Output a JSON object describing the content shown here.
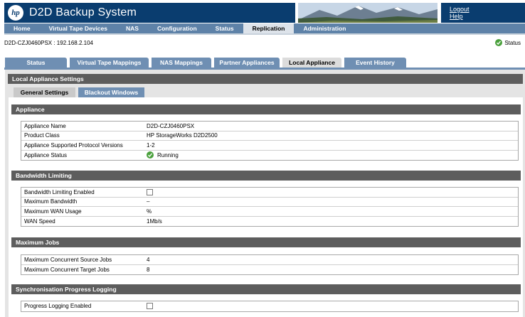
{
  "header": {
    "logo_text": "hp",
    "title": "D2D Backup System",
    "logout_label": "Logout",
    "help_label": "Help"
  },
  "nav": {
    "items": [
      "Home",
      "Virtual Tape Devices",
      "NAS",
      "Configuration",
      "Status",
      "Replication",
      "Administration"
    ],
    "active": "Replication"
  },
  "host": {
    "line": "D2D-CZJ0460PSX : 192.168.2.104",
    "status_label": "Status"
  },
  "tabs": {
    "items": [
      "Status",
      "Virtual Tape Mappings",
      "NAS Mappings",
      "Partner Appliances",
      "Local Appliance",
      "Event History"
    ],
    "active": "Local Appliance"
  },
  "panel": {
    "title": "Local Appliance Settings",
    "subtabs": [
      "General Settings",
      "Blackout Windows"
    ],
    "active_subtab": "General Settings"
  },
  "sections": {
    "appliance": {
      "title": "Appliance",
      "rows": [
        {
          "label": "Appliance Name",
          "value": "D2D-CZJ0460PSX"
        },
        {
          "label": "Product Class",
          "value": "HP StorageWorks D2D2500"
        },
        {
          "label": "Appliance Supported Protocol Versions",
          "value": "1-2"
        },
        {
          "label": "Appliance Status",
          "value": "Running"
        }
      ]
    },
    "bandwidth": {
      "title": "Bandwidth Limiting",
      "rows": [
        {
          "label": "Bandwidth Limiting Enabled",
          "value": ""
        },
        {
          "label": "Maximum Bandwidth",
          "value": "–"
        },
        {
          "label": "Maximum WAN Usage",
          "value": "%"
        },
        {
          "label": "WAN Speed",
          "value": "1Mb/s"
        }
      ]
    },
    "jobs": {
      "title": "Maximum Jobs",
      "rows": [
        {
          "label": "Maximum Concurrent Source Jobs",
          "value": "4"
        },
        {
          "label": "Maximum Concurrent Target Jobs",
          "value": "8"
        }
      ]
    },
    "sync": {
      "title": "Synchronisation Progress Logging",
      "rows": [
        {
          "label": "Progress Logging Enabled",
          "value": ""
        }
      ]
    }
  },
  "colors": {
    "brand": "#0a3d6f",
    "nav": "#5e82a8",
    "tab": "#6f8fb3",
    "section": "#5d5d5d",
    "ok": "#4aa03c"
  },
  "icons": {
    "status_ok": "check-circle-icon",
    "photo": "mountain-landscape-image"
  }
}
